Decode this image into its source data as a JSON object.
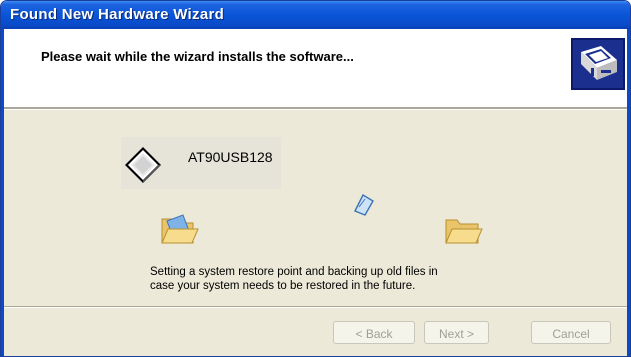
{
  "window": {
    "title": "Found New Hardware Wizard"
  },
  "header": {
    "heading": "Please wait while the wizard installs the software...",
    "icon": "hardware-wizard-icon"
  },
  "install": {
    "device_name": "AT90USB128",
    "device_icon": "usb-device-icon",
    "source_icon": "open-folder-icon",
    "transfer_icon": "flying-document-icon",
    "target_icon": "folder-icon",
    "status_line1": "Setting a system restore point and backing up old files in",
    "status_line2": "case your system needs to be restored in the future."
  },
  "buttons": {
    "back": "< Back",
    "next": "Next >",
    "cancel": "Cancel"
  },
  "colors": {
    "titlebar": "#0a55d8",
    "dialog_bg": "#ece9d8",
    "header_bg": "#ffffff"
  }
}
